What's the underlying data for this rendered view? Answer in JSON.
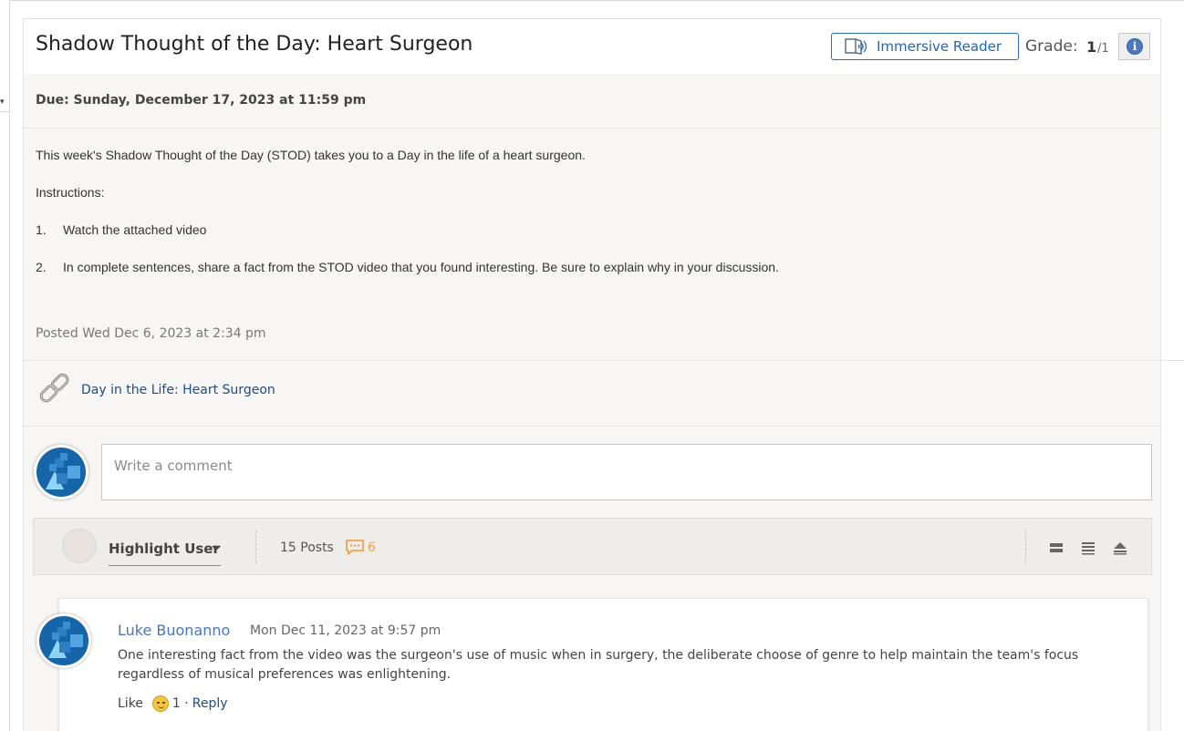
{
  "header": {
    "title": "Shadow Thought of the Day: Heart Surgeon",
    "immersive_reader_label": "Immersive Reader",
    "grade_label": "Grade:",
    "grade_value": "1",
    "grade_max": "/1",
    "info_glyph": "i"
  },
  "assignment": {
    "due": "Due: Sunday, December 17, 2023 at 11:59 pm",
    "intro": "This week's Shadow Thought of the Day (STOD) takes you to a Day in the life of a heart surgeon.",
    "instructions_label": "Instructions:",
    "steps": [
      {
        "num": "1.",
        "text": "Watch the attached video"
      },
      {
        "num": "2.",
        "text": "In complete sentences, share a fact from the STOD video that you found interesting. Be sure to explain why in your discussion."
      }
    ],
    "posted": "Posted Wed Dec 6, 2023 at 2:34 pm",
    "attachment_link": "Day in the Life: Heart Surgeon"
  },
  "comment_input": {
    "placeholder": "Write a comment"
  },
  "toolbar": {
    "highlight_user_label": "Highlight User",
    "posts_count": "15 Posts",
    "unread_count": "6",
    "view_icons": [
      "collapsed-view-icon",
      "expanded-view-icon",
      "collapse-all-icon"
    ]
  },
  "posts": [
    {
      "author": "Luke Buonanno",
      "date": "Mon Dec 11, 2023 at 9:57 pm",
      "body": "One interesting fact from the video was the surgeon's use of music when in surgery, the deliberate choose of genre to help maintain the team's focus regardless of musical preferences was enlightening.",
      "like_label": "Like",
      "like_count": "1 ·",
      "reply_label": "Reply"
    }
  ],
  "colors": {
    "accent_blue": "#1f67b0",
    "link_blue": "#1f4e82",
    "author_blue": "#4a76b8",
    "unread_orange": "#f0a24b",
    "panel_bg": "#f7f6f5"
  }
}
